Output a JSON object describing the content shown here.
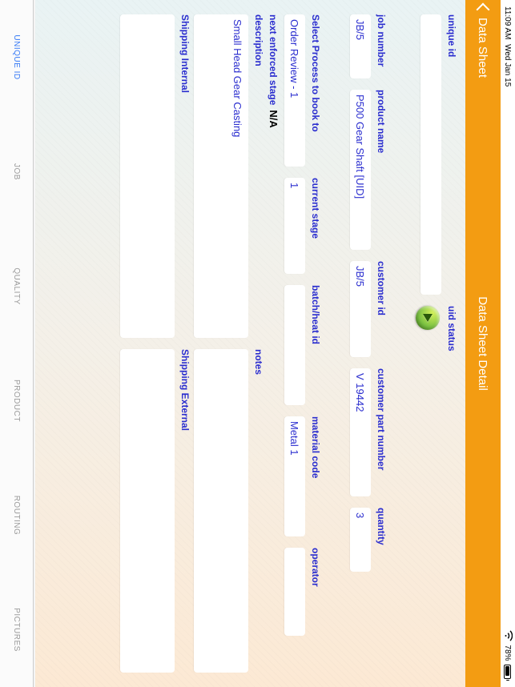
{
  "status": {
    "time": "11:09 AM",
    "date": "Wed Jan 15",
    "battery": "78%"
  },
  "nav": {
    "back_label": "Data Sheet",
    "title": "Data Sheet Detail"
  },
  "fields": {
    "unique_id_label": "unique id",
    "unique_id_value": "",
    "uid_status_label": "uid status",
    "job_number_label": "job number",
    "job_number_value": "JB/5",
    "product_name_label": "product name",
    "product_name_value": "P500 Gear Shaft [UID]",
    "customer_id_label": "customer id",
    "customer_id_value": "JB/5",
    "customer_pn_label": "customer part number",
    "customer_pn_value": "V 19442",
    "quantity_label": "quantity",
    "quantity_value": "3",
    "process_label": "Select Process to book to",
    "process_value": "Order Review - 1",
    "current_stage_label": "current stage",
    "current_stage_value": "1",
    "batch_label": "batch/heat id",
    "batch_value": "",
    "material_label": "material code",
    "material_value": "Metal 1",
    "operator_label": "operator",
    "operator_value": "",
    "next_stage_label": "next enforced stage",
    "next_stage_value": "N/A",
    "description_label": "description",
    "description_value": "Small Head Gear Casting",
    "notes_label": "notes",
    "notes_value": "",
    "ship_internal_label": "Shipping Internal",
    "ship_internal_value": "",
    "ship_external_label": "Shipping External",
    "ship_external_value": ""
  },
  "tabs": {
    "active_index": 0,
    "items": [
      {
        "label": "UNIQUE ID"
      },
      {
        "label": "JOB"
      },
      {
        "label": "QUALITY"
      },
      {
        "label": "PRODUCT"
      },
      {
        "label": "ROUTING"
      },
      {
        "label": "PICTURES"
      }
    ]
  }
}
